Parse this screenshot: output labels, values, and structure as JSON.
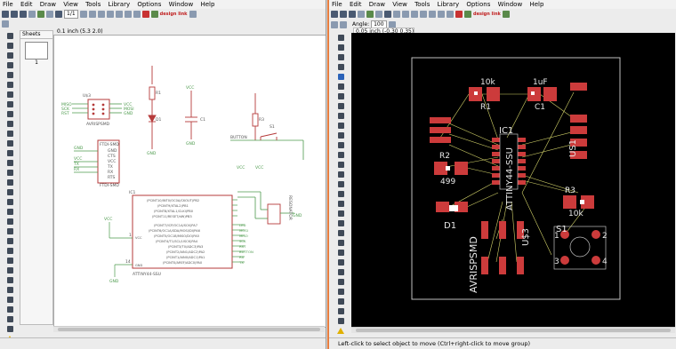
{
  "schematic": {
    "menu": [
      "File",
      "Edit",
      "Draw",
      "View",
      "Tools",
      "Library",
      "Options",
      "Window",
      "Help"
    ],
    "zoom_select": "1/1",
    "brand": "design link",
    "info": "0.1 inch (5.3 2.0)",
    "sheets_title": "Sheets",
    "sheet_number": "1",
    "labels": {
      "avrisp_ref": "U$3",
      "avrisp_name": "AVRISPSMD",
      "isp_pins_l": [
        "MISO",
        "SCK",
        "RST"
      ],
      "isp_pins_r": [
        "VCC",
        "MOSI",
        "GND"
      ],
      "ftdi_ref": "FTDI-SMD",
      "ftdi_pins": [
        "GND",
        "CTS",
        "VCC",
        "TX",
        "RX",
        "RTS"
      ],
      "ftdi_name": "FTDI-SMD",
      "nets_ftdi": [
        "GND",
        "",
        "VCC",
        "TX",
        "RX",
        ""
      ],
      "r1": "R1",
      "d1": "D1",
      "c1_cap": "C1",
      "r3": "R3",
      "button": "BUTTON",
      "s1": "S1",
      "resonator": "RESONATOR",
      "ic_ref": "IC1",
      "ic_name": "ATTINY44-SSU",
      "ic_pins_right": [
        "(PCINT10/INT0/OC0A/CKOUT)PB2",
        "(PCINT9/XTAL2)PB1",
        "(PCINT8/XTAL1/CLKI)PB0",
        "(PCINT11/RESET/dW)PB3",
        "(PCINT7/ICP/OC1A/SCK)PA7",
        "(PCINT6/OC1A/SDA/MOSI/DI)PA6",
        "(PCINT5/OC1B/MISO/DO)PA5",
        "(PCINT4/T1/SCL/USCK)PA4",
        "(PCINT3/T0/ADC3)PA3",
        "(PCINT2/AIN1/ADC2)PA2",
        "(PCINT1/AIN0/ADC1)PA1",
        "(PCINT0/AREF/ADC0)PA0"
      ],
      "ic_net_right": [
        "",
        "",
        "",
        "",
        "LED",
        "MOSI",
        "MISO",
        "SCK",
        "RST",
        "BUTTON",
        "RX",
        "TX"
      ],
      "ic_left": [
        "VCC",
        "GND"
      ],
      "pin_vcc": "1",
      "pin_gnd": "14",
      "vcc": "VCC",
      "gnd": "GND"
    }
  },
  "board": {
    "menu": [
      "File",
      "Edit",
      "Draw",
      "View",
      "Tools",
      "Library",
      "Options",
      "Window",
      "Help"
    ],
    "angle_label": "Angle:",
    "angle_value": "100",
    "info": "0.05 inch (-0.30 0.35)",
    "status": "Left-click to select object to move (Ctrl+right-click to move group)",
    "parts": {
      "r1": "R1",
      "r1_val": "10k",
      "c1": "C1",
      "c1_val": "1uF",
      "r2": "R2",
      "r2_val": "499",
      "r3": "R3",
      "r3_val": "10k",
      "ic": "IC1",
      "ic_name": "ATTINY44-SSU",
      "d1": "D1",
      "us1": "US1",
      "u3": "U$3",
      "isp": "AVRISPSMD",
      "s1": "S1",
      "s1_pins": [
        "1",
        "2",
        "3",
        "4"
      ]
    }
  },
  "colors": {
    "board_bg": "#000000",
    "pad": "#cc3b3b",
    "airwire": "#d4d46a",
    "outline": "#c0c0c0",
    "sch_green": "#4c9a4c",
    "sch_red": "#b53a3a",
    "accent": "#e87d3e"
  }
}
